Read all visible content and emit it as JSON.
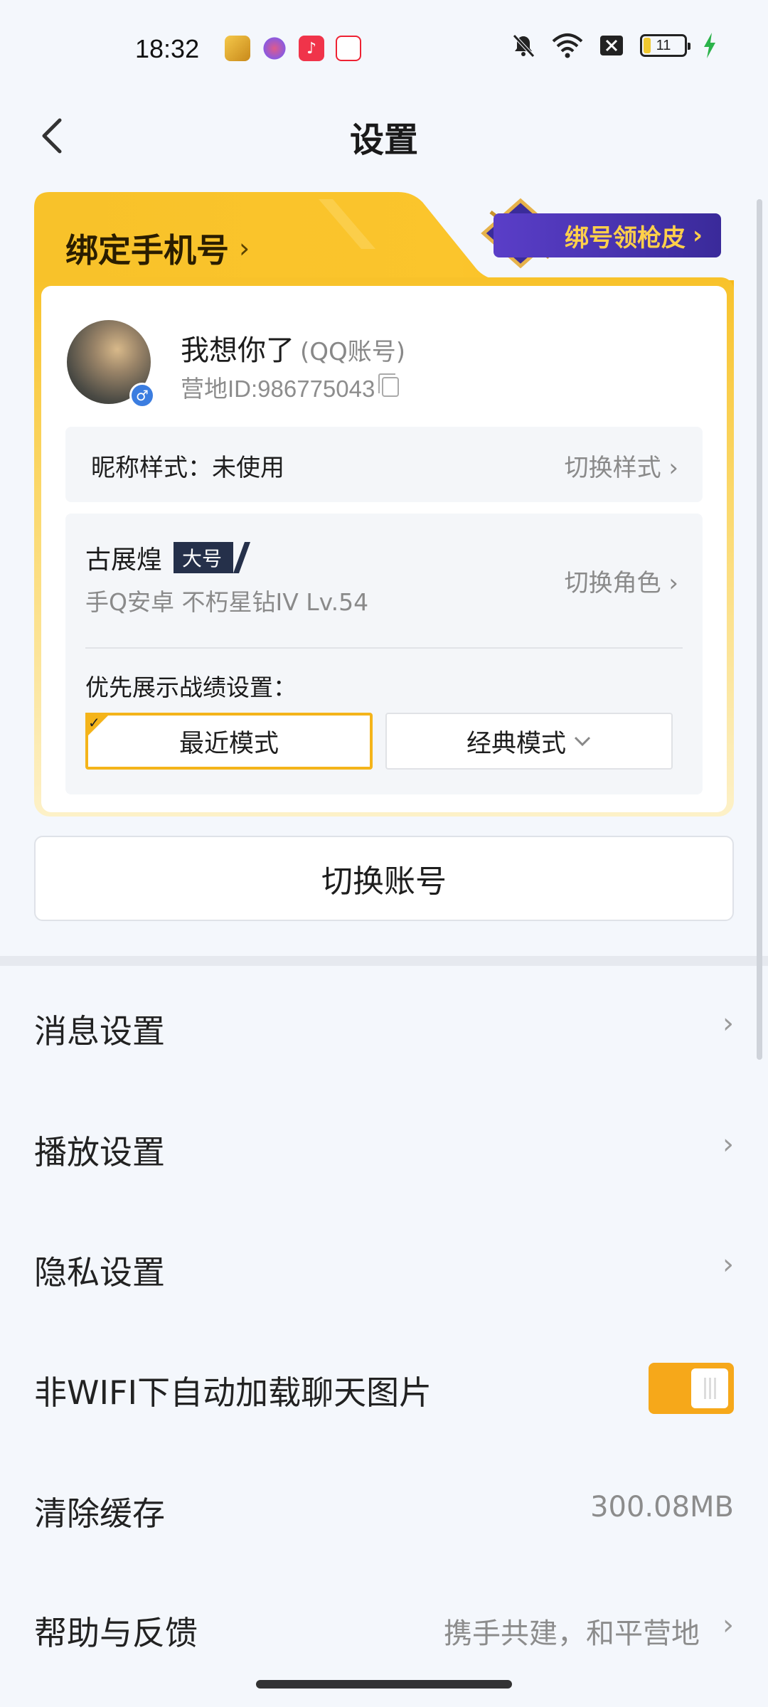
{
  "status_bar": {
    "time": "18:32",
    "battery": "11",
    "icons": [
      "app-icon-1",
      "app-icon-2",
      "music-icon",
      "app-icon-4",
      "mute-icon",
      "wifi-icon",
      "close-box-icon",
      "battery-icon",
      "charging-icon"
    ]
  },
  "header": {
    "title": "设置",
    "back_icon": "chevron-left-icon"
  },
  "account_card": {
    "bind_phone": "绑定手机号",
    "bind_reward": "绑号领枪皮",
    "nickname": "我想你了",
    "account_type": "(QQ账号)",
    "camp_id": "营地ID:986775043",
    "nickname_style_label": "昵称样式：未使用",
    "nickname_style_action": "切换样式",
    "role_name": "古展煌",
    "role_tag": "大号",
    "role_info": "手Q安卓  不朽星钻IV  Lv.54",
    "role_action": "切换角色",
    "pref_label": "优先展示战绩设置：",
    "mode_recent": "最近模式",
    "mode_classic": "经典模式"
  },
  "switch_account": "切换账号",
  "menu": {
    "message": "消息设置",
    "playback": "播放设置",
    "privacy": "隐私设置",
    "auto_load": "非WIFI下自动加载聊天图片",
    "auto_load_on": true,
    "clear_cache": "清除缓存",
    "cache_size": "300.08MB",
    "help": "帮助与反馈",
    "help_slogan": "携手共建，和平营地"
  },
  "colors": {
    "accent": "#f6a81a",
    "card_gold": "#f8c22a",
    "bg": "#f4f7fc"
  }
}
